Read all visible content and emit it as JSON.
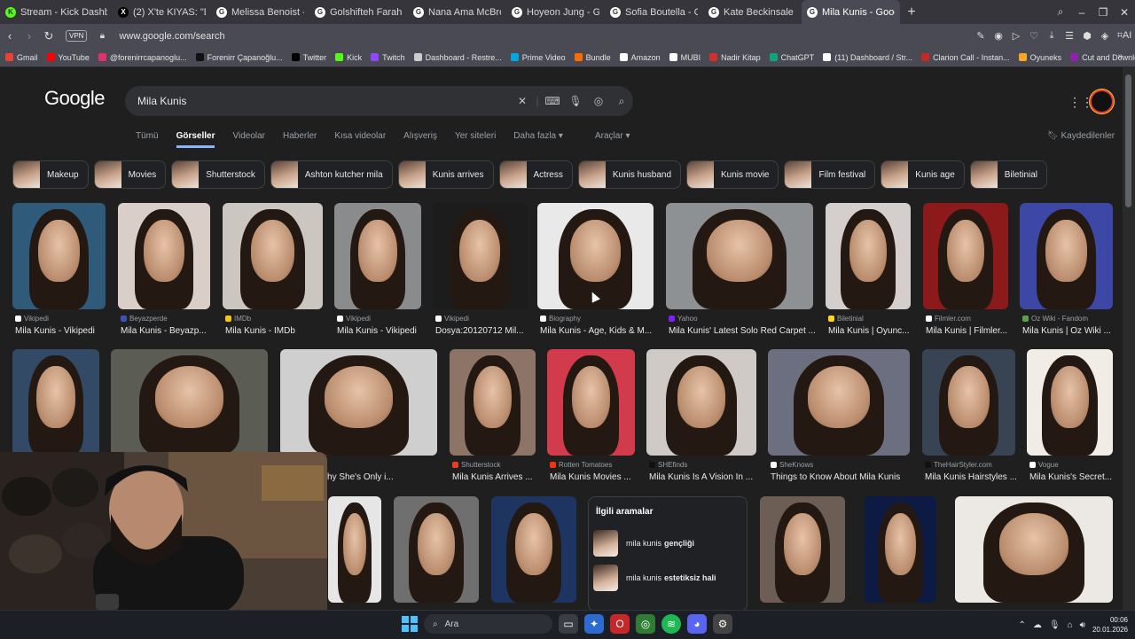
{
  "tabs": [
    {
      "title": "Stream - Kick Dashboard",
      "fav": "K",
      "color": "#53fc18"
    },
    {
      "title": "(2) X'te KIYAS: \"Dünyanın",
      "fav": "X",
      "color": "#000000"
    },
    {
      "title": "Melissa Benoist - Google'",
      "fav": "G",
      "color": "#ffffff"
    },
    {
      "title": "Golshifteh Farahani - Goo",
      "fav": "G",
      "color": "#ffffff"
    },
    {
      "title": "Nana Ama McBrown - Go",
      "fav": "G",
      "color": "#ffffff"
    },
    {
      "title": "Hoyeon Jung - Google'da",
      "fav": "G",
      "color": "#ffffff"
    },
    {
      "title": "Sofia Boutella - Google'da",
      "fav": "G",
      "color": "#ffffff"
    },
    {
      "title": "Kate Beckinsale - Google'",
      "fav": "G",
      "color": "#ffffff"
    },
    {
      "title": "Mila Kunis - Google'da A",
      "fav": "G",
      "color": "#ffffff",
      "active": true
    }
  ],
  "address": {
    "url": "www.google.com/search",
    "vpn": "VPN"
  },
  "bookmarks": [
    {
      "label": "Gmail",
      "color": "#ea4335"
    },
    {
      "label": "YouTube",
      "color": "#ff0000"
    },
    {
      "label": "@forenirrcapanoglu...",
      "color": "#e1306c"
    },
    {
      "label": "Forenirr Çapanoğlu...",
      "color": "#111111"
    },
    {
      "label": "Twitter",
      "color": "#000000"
    },
    {
      "label": "Kick",
      "color": "#53fc18"
    },
    {
      "label": "Twitch",
      "color": "#9146ff"
    },
    {
      "label": "Dashboard - Restre...",
      "color": "#cccccc"
    },
    {
      "label": "Prime Video",
      "color": "#00a8e1"
    },
    {
      "label": "Bundle",
      "color": "#ff6b00"
    },
    {
      "label": "Amazon",
      "color": "#ffffff"
    },
    {
      "label": "MUBI",
      "color": "#ffffff"
    },
    {
      "label": "Nadir Kitap",
      "color": "#d32f2f"
    },
    {
      "label": "ChatGPT",
      "color": "#10a37f"
    },
    {
      "label": "(11) Dashboard / Str...",
      "color": "#ffffff"
    },
    {
      "label": "Clarion Call - Instan...",
      "color": "#c62828"
    },
    {
      "label": "Oyuneks",
      "color": "#f9a825"
    },
    {
      "label": "Cut and Download...",
      "color": "#8e24aa"
    }
  ],
  "google": {
    "logo": "Google",
    "query": "Mila Kunis",
    "filters": [
      "Tümü",
      "Görseller",
      "Videolar",
      "Haberler",
      "Kısa videolar",
      "Alışveriş",
      "Yer siteleri",
      "Daha fazla ▾"
    ],
    "active_filter": "Görseller",
    "tools": "Araçlar ▾",
    "saved": "Kaydedilenler"
  },
  "chips": [
    "Makeup",
    "Movies",
    "Shutterstock",
    "Ashton kutcher mila",
    "Kunis arrives",
    "Actress",
    "Kunis husband",
    "Kunis movie",
    "Film festival",
    "Kunis age",
    "Biletinial"
  ],
  "row1": [
    {
      "source": "Vikipedi",
      "title": "Mila Kunis - Vikipedi",
      "bg": "#2f5a7a",
      "ic": "#ffffff"
    },
    {
      "source": "Beyazperde",
      "title": "Mila Kunis - Beyazp...",
      "bg": "#d9cfc8",
      "ic": "#3f51b5"
    },
    {
      "source": "IMDb",
      "title": "Mila Kunis - IMDb",
      "bg": "#ccc6c0",
      "ic": "#f5c518"
    },
    {
      "source": "Vikipedi",
      "title": "Mila Kunis - Vikipedi",
      "bg": "#8a8b8c",
      "ic": "#ffffff"
    },
    {
      "source": "Vikipedi",
      "title": "Dosya:20120712 Mil...",
      "bg": "#1c1c1c",
      "ic": "#ffffff"
    },
    {
      "source": "Biography",
      "title": "Mila Kunis - Age, Kids & M...",
      "bg": "#e9e9e9",
      "ic": "#ffffff"
    },
    {
      "source": "Yahoo",
      "title": "Mila Kunis' Latest Solo Red Carpet ...",
      "bg": "#8e9194",
      "ic": "#7e1fff"
    },
    {
      "source": "Biletinial",
      "title": "Mila Kunis | Oyunc...",
      "bg": "#d4cfcc",
      "ic": "#f9d71c"
    },
    {
      "source": "Filmler.com",
      "title": "Mila Kunis | Filmler...",
      "bg": "#8c1a1a",
      "ic": "#ffffff"
    },
    {
      "source": "Oz Wiki - Fandom",
      "title": "Mila Kunis | Oz Wiki ...",
      "bg": "#3d48a6",
      "ic": "#5fa04e"
    }
  ],
  "row2": [
    {
      "source": "",
      "title": "",
      "bg": "#334a66",
      "ic": "#ffffff"
    },
    {
      "source": "",
      "title": "",
      "bg": "#5b5d55",
      "ic": "#ffffff"
    },
    {
      "source": "...om",
      "title": "Explains Why She's Only i...",
      "bg": "#cfcfcf",
      "ic": "#ffffff"
    },
    {
      "source": "Shutterstock",
      "title": "Mila Kunis Arrives ...",
      "bg": "#8c7566",
      "ic": "#ef3b24"
    },
    {
      "source": "Rotten Tomatoes",
      "title": "Mila Kunis Movies ...",
      "bg": "#d23b4b",
      "ic": "#fa320a"
    },
    {
      "source": "SHEfinds",
      "title": "Mila Kunis Is A Vision In ...",
      "bg": "#d0cac6",
      "ic": "#111111"
    },
    {
      "source": "SheKnows",
      "title": "Things to Know About Mila Kunis",
      "bg": "#6b6f80",
      "ic": "#ffffff"
    },
    {
      "source": "TheHairStyler.com",
      "title": "Mila Kunis Hairstyles ...",
      "bg": "#384354",
      "ic": "#111111"
    },
    {
      "source": "Vogue",
      "title": "Mila Kunis's Secret...",
      "bg": "#f2ece6",
      "ic": "#ffffff"
    }
  ],
  "row3": [
    {
      "bg": "#e6e6e6"
    },
    {
      "bg": "#6f6f6f"
    },
    {
      "bg": "#1d3560"
    },
    {
      "bg": "#6d5e55"
    },
    {
      "bg": "#0d1b44"
    },
    {
      "bg": "#ece8e3"
    }
  ],
  "related": {
    "heading": "İlgili aramalar",
    "items": [
      {
        "prefix": "mila kunis",
        "bold": "gençliği"
      },
      {
        "prefix": "mila kunis",
        "bold": "estetiksiz hali"
      }
    ]
  },
  "taskbar": {
    "search_placeholder": "Ara",
    "time": "00:06",
    "date": "20.01.2026"
  }
}
